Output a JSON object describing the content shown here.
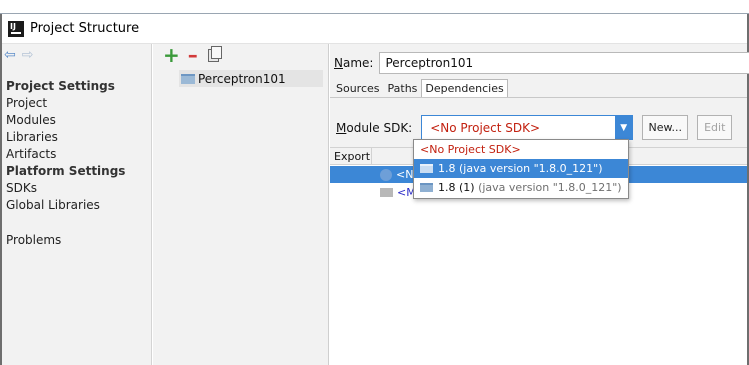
{
  "window": {
    "title": "Project Structure"
  },
  "sidebar": {
    "sections": [
      {
        "header": "Project Settings",
        "items": [
          "Project",
          "Modules",
          "Libraries",
          "Artifacts"
        ]
      },
      {
        "header": "Platform Settings",
        "items": [
          "SDKs",
          "Global Libraries"
        ]
      }
    ],
    "problems": "Problems"
  },
  "modules_panel": {
    "module_name": "Perceptron101"
  },
  "module_settings": {
    "name_label_accel": "N",
    "name_label_rest": "ame:",
    "name_value": "Perceptron101",
    "tabs": [
      "Sources",
      "Paths",
      "Dependencies"
    ],
    "active_tab": "Dependencies",
    "sdk_label_accel": "M",
    "sdk_label_rest": "odule SDK:",
    "sdk_selected": "<No Project SDK>",
    "new_button": "New...",
    "edit_button": "Edit",
    "deps_header": "Export",
    "deps_rows": [
      {
        "text": "<N",
        "selected": true
      },
      {
        "text": "<Module source>",
        "selected": false
      }
    ]
  },
  "sdk_dropdown": {
    "options": [
      {
        "name": "<No Project SDK>",
        "detail": ""
      },
      {
        "name": "1.8",
        "detail": "(java version \"1.8.0_121\")"
      },
      {
        "name": "1.8 (1)",
        "detail": "(java version \"1.8.0_121\")"
      }
    ],
    "highlighted_index": 1
  },
  "colors": {
    "accent": "#3c87d6",
    "no_sdk_red": "#c2200f",
    "panel_bg": "#f2f2f2"
  },
  "icons": {
    "nav_back": "arrow-left-icon",
    "nav_forward": "arrow-right-icon",
    "add": "plus-icon",
    "remove": "minus-icon",
    "copy": "copy-icon",
    "module": "module-folder-icon",
    "jdk": "jdk-icon",
    "source_folder": "folder-icon",
    "dropdown_arrow": "chevron-down-icon"
  }
}
